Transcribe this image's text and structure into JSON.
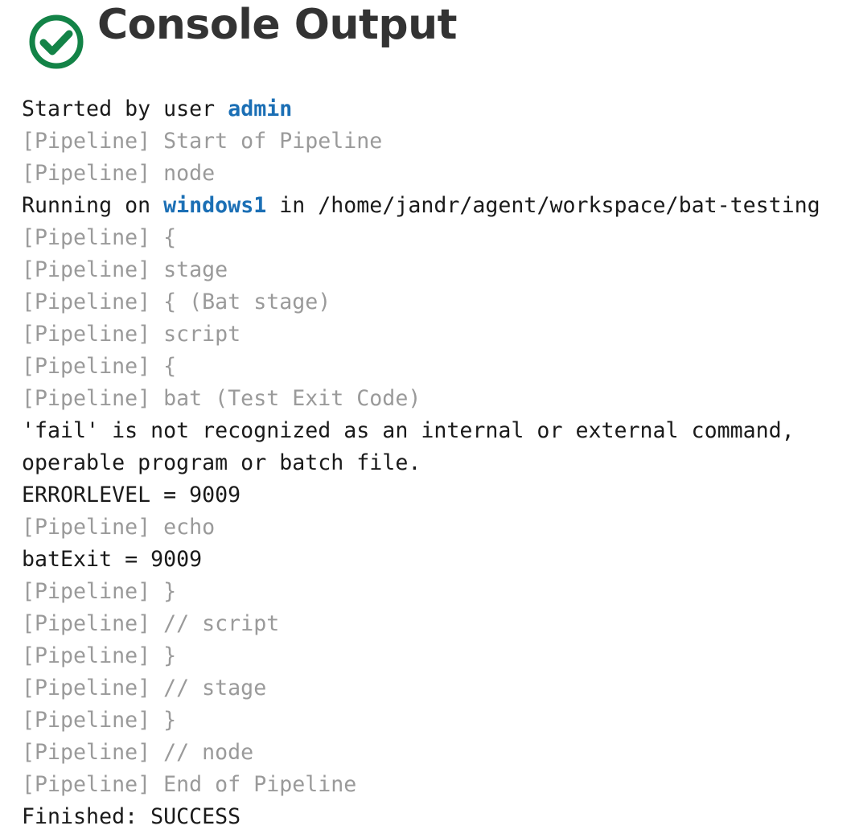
{
  "header": {
    "status_icon": "check-circle-icon",
    "status": "success",
    "status_color": "#138347",
    "title": "Console Output"
  },
  "colors": {
    "text": "#1a1a1a",
    "pipeline_text": "#9a9a9a",
    "link": "#1b6fb5",
    "title": "#333333"
  },
  "console": {
    "started": {
      "prefix": "Started by user ",
      "user_link": "admin"
    },
    "running": {
      "prefix": "Running on ",
      "node_link": "windows1",
      "suffix": " in /home/jandr/agent/workspace/bat-testing"
    },
    "lines": [
      "[Pipeline] Start of Pipeline",
      "[Pipeline] node",
      "[Pipeline] {",
      "[Pipeline] stage",
      "[Pipeline] { (Bat stage)",
      "[Pipeline] script",
      "[Pipeline] {",
      "[Pipeline] bat (Test Exit Code)",
      "'fail' is not recognized as an internal or external command,",
      "operable program or batch file.",
      "ERRORLEVEL = 9009",
      "[Pipeline] echo",
      "batExit = 9009",
      "[Pipeline] }",
      "[Pipeline] // script",
      "[Pipeline] }",
      "[Pipeline] // stage",
      "[Pipeline] }",
      "[Pipeline] // node",
      "[Pipeline] End of Pipeline",
      "Finished: SUCCESS"
    ]
  }
}
